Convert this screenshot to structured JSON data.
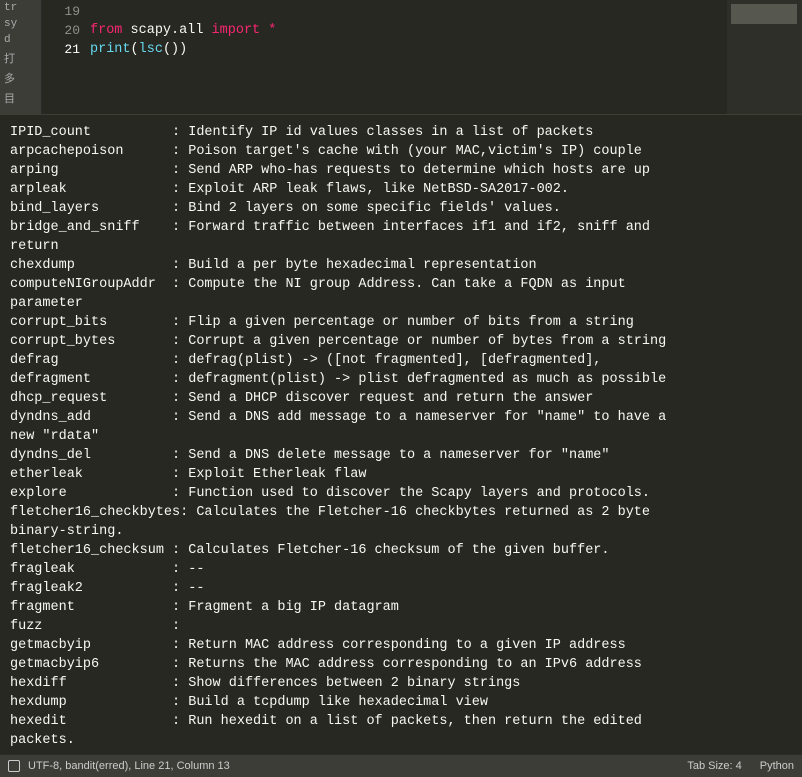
{
  "side_tabs": [
    "tr",
    "sy",
    "d",
    "打",
    "多",
    "目"
  ],
  "code": {
    "lines": [
      {
        "num": "19",
        "tokens": []
      },
      {
        "num": "20",
        "tokens": [
          {
            "t": "from",
            "c": "kw-import"
          },
          {
            "t": " "
          },
          {
            "t": "scapy.all",
            "c": "mod"
          },
          {
            "t": " "
          },
          {
            "t": "import",
            "c": "kw-import"
          },
          {
            "t": " "
          },
          {
            "t": "*",
            "c": "star"
          }
        ]
      },
      {
        "num": "21",
        "current": true,
        "tokens": [
          {
            "t": "print",
            "c": "fn"
          },
          {
            "t": "(",
            "c": "paren"
          },
          {
            "t": "lsc",
            "c": "call"
          },
          {
            "t": "()",
            "c": "paren"
          },
          {
            "t": ")",
            "c": "paren"
          }
        ]
      }
    ]
  },
  "output_lines": [
    "IPID_count          : Identify IP id values classes in a list of packets",
    "arpcachepoison      : Poison target's cache with (your MAC,victim's IP) couple",
    "arping              : Send ARP who-has requests to determine which hosts are up",
    "arpleak             : Exploit ARP leak flaws, like NetBSD-SA2017-002.",
    "bind_layers         : Bind 2 layers on some specific fields' values.",
    "bridge_and_sniff    : Forward traffic between interfaces if1 and if2, sniff and",
    "return",
    "chexdump            : Build a per byte hexadecimal representation",
    "computeNIGroupAddr  : Compute the NI group Address. Can take a FQDN as input",
    "parameter",
    "corrupt_bits        : Flip a given percentage or number of bits from a string",
    "corrupt_bytes       : Corrupt a given percentage or number of bytes from a string",
    "defrag              : defrag(plist) -> ([not fragmented], [defragmented],",
    "defragment          : defragment(plist) -> plist defragmented as much as possible",
    "dhcp_request        : Send a DHCP discover request and return the answer",
    "dyndns_add          : Send a DNS add message to a nameserver for \"name\" to have a",
    "new \"rdata\"",
    "dyndns_del          : Send a DNS delete message to a nameserver for \"name\"",
    "etherleak           : Exploit Etherleak flaw",
    "explore             : Function used to discover the Scapy layers and protocols.",
    "fletcher16_checkbytes: Calculates the Fletcher-16 checkbytes returned as 2 byte",
    "binary-string.",
    "fletcher16_checksum : Calculates Fletcher-16 checksum of the given buffer.",
    "fragleak            : --",
    "fragleak2           : --",
    "fragment            : Fragment a big IP datagram",
    "fuzz                : ",
    "getmacbyip          : Return MAC address corresponding to a given IP address",
    "getmacbyip6         : Returns the MAC address corresponding to an IPv6 address",
    "hexdiff             : Show differences between 2 binary strings",
    "hexdump             : Build a tcpdump like hexadecimal view",
    "hexedit             : Run hexedit on a list of packets, then return the edited",
    "packets."
  ],
  "statusbar": {
    "encoding": "UTF-8, bandit(erred), Line 21, Column 13",
    "tab_size": "Tab Size: 4",
    "syntax": "Python"
  }
}
